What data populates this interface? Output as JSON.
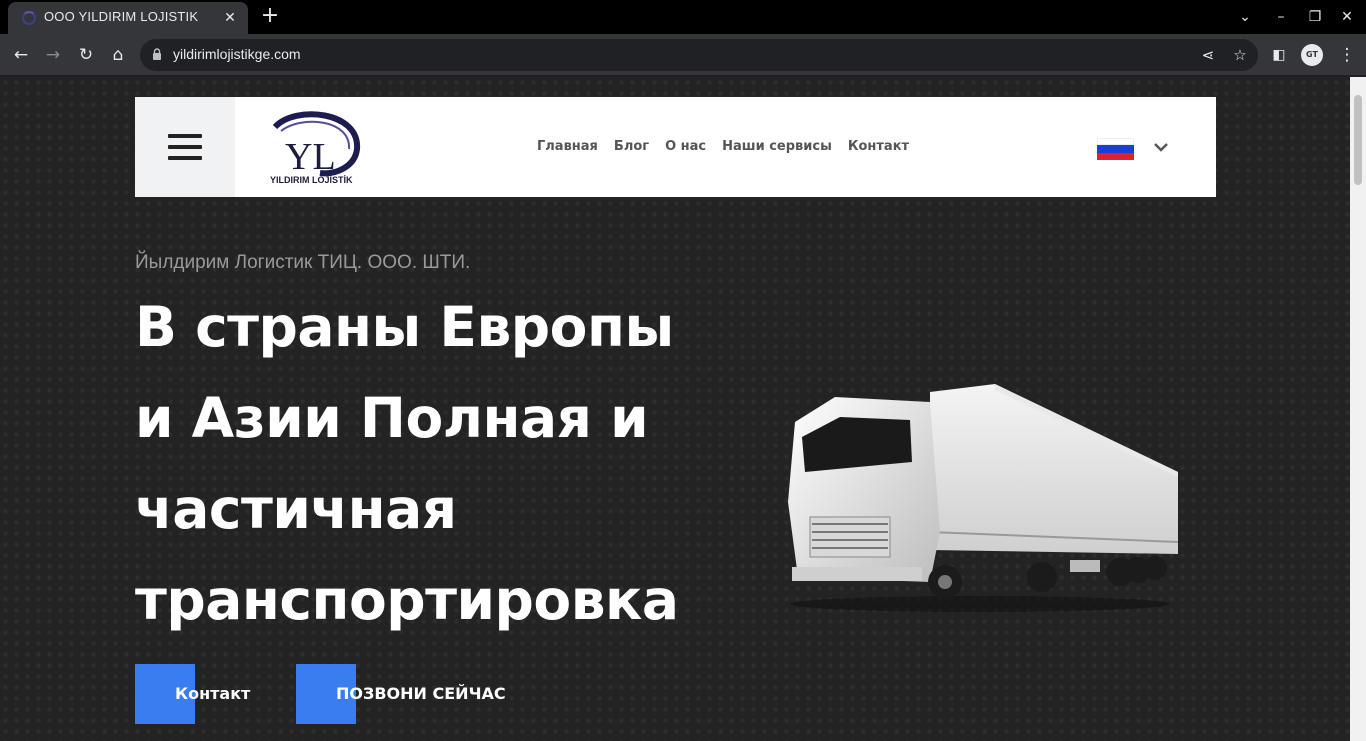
{
  "browser": {
    "tab_title": "OOO YILDIRIM LOJISTIK",
    "url": "yildirimlojistikge.com",
    "profile_initials": "GT"
  },
  "site": {
    "logo_letters": "YL",
    "logo_text": "YILDIRIM LOJİSTİK",
    "menu": [
      "Главная",
      "Блог",
      "О нас",
      "Наши сервисы",
      "Контакт"
    ],
    "language_flag": "ru-flag",
    "flag_colors": [
      "#ffffff",
      "#1c3fcf",
      "#e0202a"
    ]
  },
  "hero": {
    "subtitle": "Йылдирим Логистик ТИЦ. ООО. ШТИ.",
    "headline_lines": [
      "В страны Европы",
      "и Азии Полная и",
      "частичная",
      "транспортировка"
    ],
    "buttons": {
      "contact": "Контакт",
      "call": "ПОЗВОНИ СЕЙЧАС"
    },
    "accent_color": "#3a7df0"
  }
}
